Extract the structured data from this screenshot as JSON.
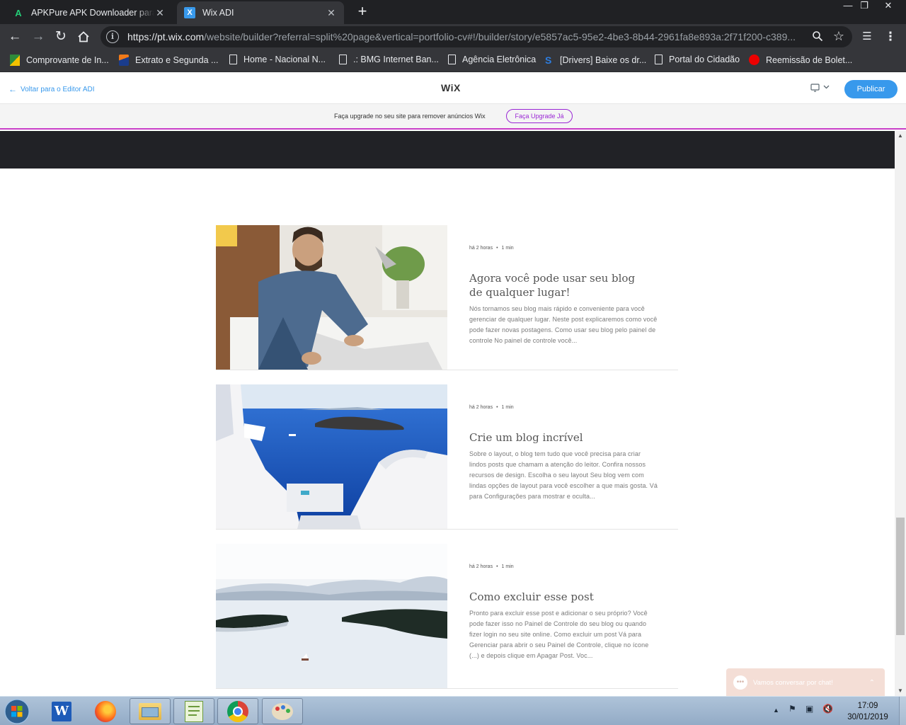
{
  "browser": {
    "tabs": [
      {
        "title": "APKPure APK Downloader para Android",
        "close": "✕"
      },
      {
        "title": "Wix ADI",
        "close": "✕"
      }
    ],
    "new_tab": "+",
    "window_controls": {
      "minimize": "—",
      "restore": "❐",
      "close": "✕"
    },
    "url_host": "https://pt.wix.com",
    "url_rest": "/website/builder?referral=split%20page&vertical=portfolio-cv#!/builder/story/e5857ac5-95e2-4be3-8b44-2961fa8e893a:2f71f200-c389...",
    "bookmarks": [
      "Comprovante de In...",
      "Extrato e Segunda ...",
      "Home - Nacional N...",
      ".: BMG Internet Ban...",
      "Agência Eletrônica",
      "[Drivers] Baixe os dr...",
      "Portal do Cidadão",
      "Reemissão de Bolet..."
    ]
  },
  "wix": {
    "back_label": "Voltar para o Editor ADI",
    "logo": "WiX",
    "publish_label": "Publicar",
    "upgrade_text": "Faça upgrade no seu site para remover anúncios Wix",
    "upgrade_button": "Faça Upgrade Já",
    "chat_label": "Vamos conversar por chat!"
  },
  "posts": [
    {
      "time": "há 2 horas",
      "read": "1 min",
      "title": "Agora você pode usar seu blog de qualquer lugar!",
      "excerpt": "Nós tornamos seu blog mais rápido e conveniente para você gerenciar de qualquer lugar. Neste post explicaremos como você pode fazer novas postagens. Como usar seu blog pelo painel de controle No painel de controle você..."
    },
    {
      "time": "há 2 horas",
      "read": "1 min",
      "title": "Crie um blog incrível",
      "excerpt": "Sobre o layout, o blog tem tudo que você precisa para criar lindos posts que chamam a atenção do leitor. Confira nossos recursos de design. Escolha o seu layout Seu blog vem com lindas opções de layout para você escolher a que mais gosta. Vá para Configurações para mostrar e oculta..."
    },
    {
      "time": "há 2 horas",
      "read": "1 min",
      "title": "Como excluir esse post",
      "excerpt": "Pronto para excluir esse post e adicionar o seu próprio? Você pode fazer isso no Painel de Controle do seu blog ou quando fizer login no seu site online. Como excluir um post Vá para Gerenciar para abrir o seu Painel de Controle, clique no ícone (...) e depois clique em Apagar Post. Voc..."
    }
  ],
  "taskbar": {
    "time": "17:09",
    "date": "30/01/2019"
  },
  "colors": {
    "wix_blue": "#3899ec",
    "upgrade_purple": "#9a27d5",
    "chrome_dark": "#35363a"
  }
}
